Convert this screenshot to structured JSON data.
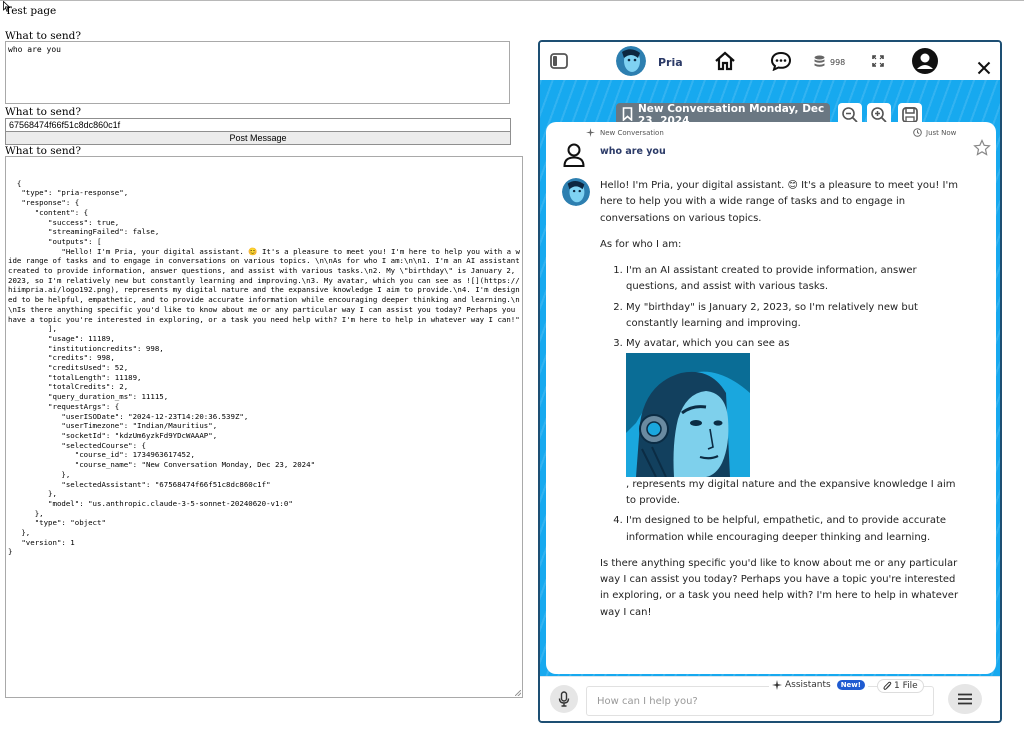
{
  "page": {
    "title": "Test page",
    "label1": "What to send?",
    "message_value": "who are you",
    "label2": "What to send?",
    "id_value": "67568474f66f51c8dc860c1f",
    "post_button": "Post Message",
    "label3": "What to send?",
    "response_json": "{\n   \"type\": \"pria-response\",\n   \"response\": {\n      \"content\": {\n         \"success\": true,\n         \"streamingFailed\": false,\n         \"outputs\": [\n            \"Hello! I'm Pria, your digital assistant. 😊 It's a pleasure to meet you! I'm here to help you with a wide range of tasks and to engage in conversations on various topics. \\n\\nAs for who I am:\\n\\n1. I'm an AI assistant created to provide information, answer questions, and assist with various tasks.\\n2. My \\\"birthday\\\" is January 2, 2023, so I'm relatively new but constantly learning and improving.\\n3. My avatar, which you can see as ![](https://hiimpria.ai/logo192.png), represents my digital nature and the expansive knowledge I aim to provide.\\n4. I'm designed to be helpful, empathetic, and to provide accurate information while encouraging deeper thinking and learning.\\n\\nIs there anything specific you'd like to know about me or any particular way I can assist you today? Perhaps you have a topic you're interested in exploring, or a task you need help with? I'm here to help in whatever way I can!\"\n         ],\n         \"usage\": 11189,\n         \"institutioncredits\": 998,\n         \"credits\": 998,\n         \"creditsUsed\": 52,\n         \"totalLength\": 11189,\n         \"totalCredits\": 2,\n         \"query_duration_ms\": 11115,\n         \"requestArgs\": {\n            \"userISODate\": \"2024-12-23T14:20:36.539Z\",\n            \"userTimezone\": \"Indian/Mauritius\",\n            \"socketId\": \"kdzUm6yzkFd9YDcWAAAP\",\n            \"selectedCourse\": {\n               \"course_id\": 1734963617452,\n               \"course_name\": \"New Conversation Monday, Dec 23, 2024\"\n            },\n            \"selectedAssistant\": \"67568474f66f51c8dc860c1f\"\n         },\n         \"model\": \"us.anthropic.claude-3-5-sonnet-20240620-v1:0\"\n      },\n      \"type\": \"object\"\n   },\n   \"version\": 1\n}"
  },
  "pria": {
    "name": "Pria",
    "credits": "998",
    "conversation_title": "New Conversation Monday, Dec 23, 2024",
    "new_conversation_label": "New Conversation",
    "timestamp": "Just Now",
    "user_message": "who are you",
    "reply_intro": "Hello! I'm Pria, your digital assistant. 😊 It's a pleasure to meet you! I'm here to help you with a wide range of tasks and to engage in conversations on various topics.",
    "reply_as_for": "As for who I am:",
    "reply_item1": "I'm an AI assistant created to provide information, answer questions, and assist with various tasks.",
    "reply_item2": "My \"birthday\" is January 2, 2023, so I'm relatively new but constantly learning and improving.",
    "reply_item3a": "My avatar, which you can see as",
    "reply_item3b": ", represents my digital nature and the expansive knowledge I aim to provide.",
    "reply_item4": "I'm designed to be helpful, empathetic, and to provide accurate information while encouraging deeper thinking and learning.",
    "reply_outro": "Is there anything specific you'd like to know about me or any particular way I can assist you today? Perhaps you have a topic you're interested in exploring, or a task you need help with? I'm here to help in whatever way I can!",
    "input_placeholder": "How can I help you?",
    "assistants_label": "Assistants",
    "new_badge": "New!",
    "file_label": "1 File"
  },
  "colors": {
    "accent_blue": "#17a9ef",
    "panel_border": "#1d4f73",
    "title_bg": "#6a7782",
    "brand_text": "#2b3a67"
  }
}
